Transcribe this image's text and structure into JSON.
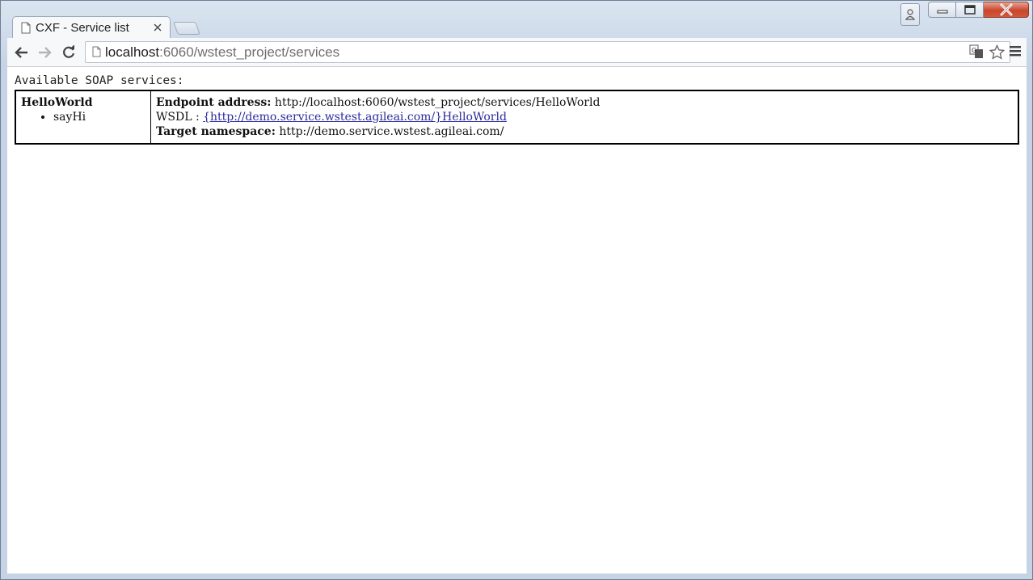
{
  "window": {
    "tab_title": "CXF - Service list"
  },
  "toolbar": {
    "url_host": "localhost",
    "url_rest": ":6060/wstest_project/services"
  },
  "page": {
    "heading": "Available SOAP services:",
    "services": [
      {
        "name": "HelloWorld",
        "operations": [
          "sayHi"
        ],
        "endpoint_label": "Endpoint address:",
        "endpoint": "http://localhost:6060/wstest_project/services/HelloWorld",
        "wsdl_label": "WSDL :",
        "wsdl": "{http://demo.service.wstest.agileai.com/}HelloWorld",
        "namespace_label": "Target namespace:",
        "namespace": "http://demo.service.wstest.agileai.com/"
      }
    ]
  }
}
